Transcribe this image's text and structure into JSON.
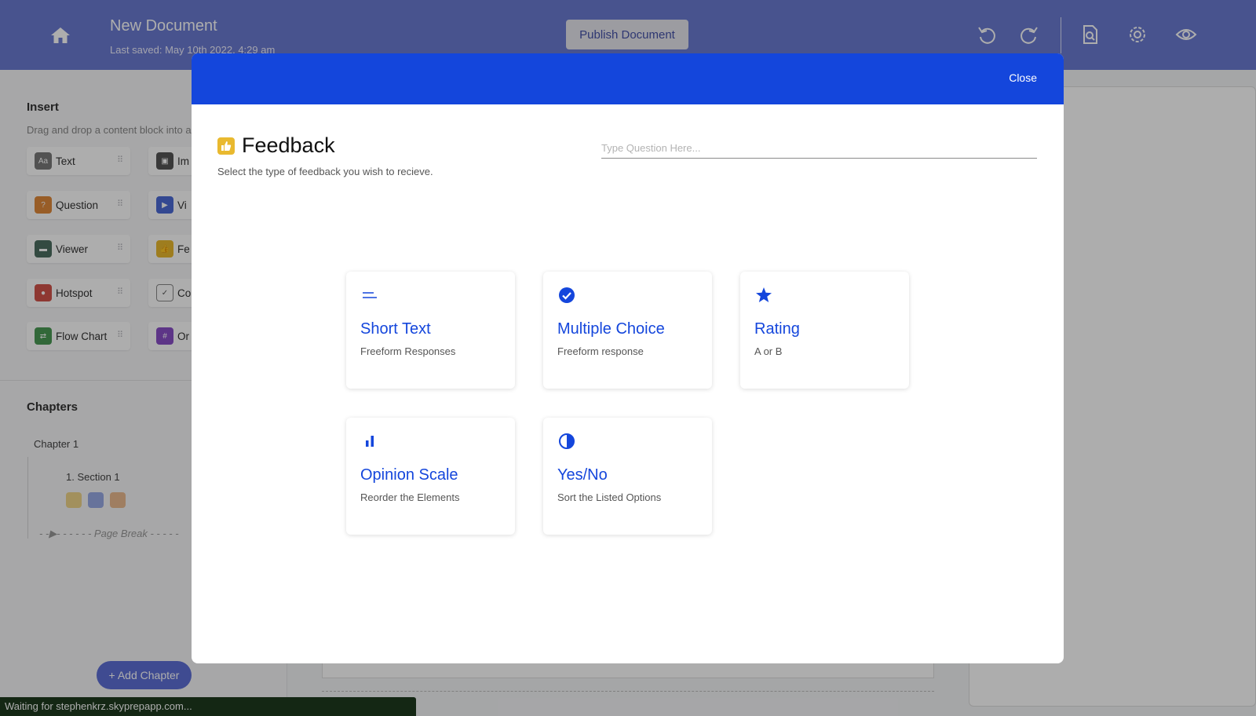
{
  "header": {
    "doc_title": "New Document",
    "last_saved": "Last saved: May 10th 2022, 4:29 am",
    "publish_label": "Publish Document",
    "icons": [
      "home-icon",
      "undo-icon",
      "redo-icon",
      "document-search-icon",
      "gear-icon",
      "eye-icon"
    ]
  },
  "sidebar": {
    "insert_title": "Insert",
    "insert_subtitle": "Drag and drop a content block into a",
    "blocks_left": [
      {
        "label": "Text",
        "icon": "text-icon",
        "color": "#7a7a7a"
      },
      {
        "label": "Question",
        "icon": "question-icon",
        "color": "#e0893a"
      },
      {
        "label": "Viewer",
        "icon": "folder-icon",
        "color": "#4c6e60"
      },
      {
        "label": "Hotspot",
        "icon": "location-pin-icon",
        "color": "#d2534a"
      },
      {
        "label": "Flow Chart",
        "icon": "flow-chart-icon",
        "color": "#4a9a55"
      }
    ],
    "blocks_right": [
      {
        "label": "Im",
        "icon": "image-icon",
        "color": "#555555"
      },
      {
        "label": "Vi",
        "icon": "video-icon",
        "color": "#4c6bd6"
      },
      {
        "label": "Fe",
        "icon": "thumbs-up-icon",
        "color": "#e9b92f"
      },
      {
        "label": "Co",
        "icon": "checkbox-icon",
        "color": "#ffffff"
      },
      {
        "label": "Or",
        "icon": "grid-icon",
        "color": "#8a4fc8"
      }
    ],
    "chapters_title": "Chapters",
    "chapter_name": "Chapter 1",
    "section_label": "1.   Section 1",
    "page_break_label": "Page Break",
    "add_chapter_label": "+ Add Chapter"
  },
  "status_bar": {
    "text": "Waiting for stephenkrz.skyprepapp.com..."
  },
  "modal": {
    "close_label": "Close",
    "title": "Feedback",
    "subtitle": "Select the type of feedback you wish to recieve.",
    "question_placeholder": "Type Question Here...",
    "accent_color": "#1446dc",
    "options": [
      {
        "title": "Short Text",
        "desc": "Freeform Responses",
        "icon": "short-text-icon"
      },
      {
        "title": "Multiple Choice",
        "desc": "Freeform response",
        "icon": "check-circle-icon"
      },
      {
        "title": "Rating",
        "desc": "A or B",
        "icon": "star-icon"
      },
      {
        "title": "Opinion Scale",
        "desc": "Reorder the Elements",
        "icon": "bar-chart-icon"
      },
      {
        "title": "Yes/No",
        "desc": "Sort the Listed Options",
        "icon": "half-circle-icon"
      }
    ]
  }
}
